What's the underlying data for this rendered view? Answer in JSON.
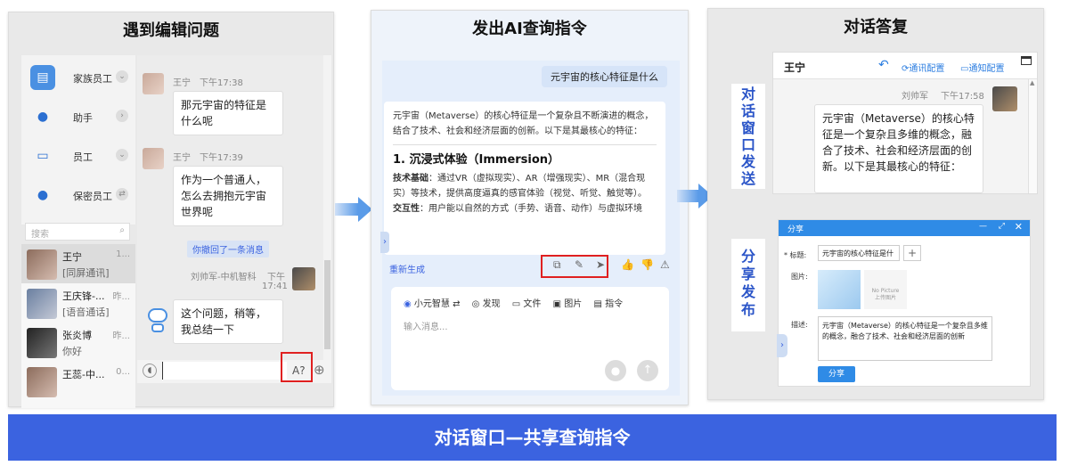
{
  "banner": {
    "title": "对话窗口—共享查询指令"
  },
  "panel1": {
    "title": "遇到编辑问题",
    "sidebar": [
      {
        "label": "家族员工",
        "icon": "id-card-icon"
      },
      {
        "label": "助手",
        "icon": "person-icon"
      },
      {
        "label": "员工",
        "icon": "badge-icon"
      },
      {
        "label": "保密员工",
        "icon": "lock-person-icon"
      }
    ],
    "search_placeholder": "搜索",
    "conversations": [
      {
        "name": "王宁",
        "time": "1...",
        "snippet": "[同屏通讯]"
      },
      {
        "name": "王庆锋-...",
        "time": "昨...",
        "snippet": "[语音通话]"
      },
      {
        "name": "张炎博",
        "time": "昨...",
        "snippet": "你好"
      },
      {
        "name": "王蕊-中...",
        "time": "0..."
      }
    ],
    "messages": [
      {
        "sender": "王宁",
        "time": "下午17:38",
        "text": "那元宇宙的特征是什么呢"
      },
      {
        "sender": "王宁",
        "time": "下午17:39",
        "text": "作为一个普通人，怎么去拥抱元宇宙世界呢"
      }
    ],
    "recall_notice": "你撤回了一条消息",
    "self_sender": "刘帅军-中机智科",
    "self_time_a": "下午",
    "self_time_b": "17:41",
    "bot_reply": "这个问题，稍等，我总结一下",
    "format_label": "A?"
  },
  "panel2": {
    "title": "发出AI查询指令",
    "user_query": "元宇宙的核心特征是什么",
    "answer_intro": "元宇宙（Metaverse）的核心特征是一个复杂且不断演进的概念，结合了技术、社会和经济层面的创新。以下是其最核心的特征：",
    "section_title": "1. 沉浸式体验（Immersion）",
    "tech_label": "技术基础",
    "tech_text": "：通过VR（虚拟现实）、AR（增强现实）、MR（混合现实）等技术，提供高度逼真的感官体验（视觉、听觉、触觉等）。",
    "interact_label": "交互性",
    "interact_text": "：用户能以自然的方式（手势、语音、动作）与虚拟环境",
    "regenerate": "重新生成",
    "tools": [
      "小元智慧",
      "发现",
      "文件",
      "图片",
      "指令"
    ],
    "input_placeholder": "输入消息..."
  },
  "panel3": {
    "title": "对话答复",
    "chat_title": "王宁",
    "link_config": "通讯配置",
    "notify_config": "通知配置",
    "sender": "刘帅军",
    "time": "下午17:58",
    "message": "元宇宙（Metaverse）的核心特征是一个复杂且多维的概念，融合了技术、社会和经济层面的创新。以下是其最核心的特征：",
    "side_label_1": "对话窗口发送",
    "side_label_2": "分享发布",
    "share": {
      "header": "分享",
      "title_label": "* 标题:",
      "title_value": "元宇宙的核心特征是什",
      "image_label": "图片:",
      "no_picture": "No Picture",
      "upload_hint": "上传图片",
      "desc_label": "描述:",
      "desc_value": "元宇宙（Metaverse）的核心特征是一个复杂且多维的概念，融合了技术、社会和经济层面的创新",
      "button": "分享"
    }
  },
  "colors": {
    "accent": "#3b63e0",
    "red": "#e02020",
    "arrow": "#5a9be8"
  }
}
